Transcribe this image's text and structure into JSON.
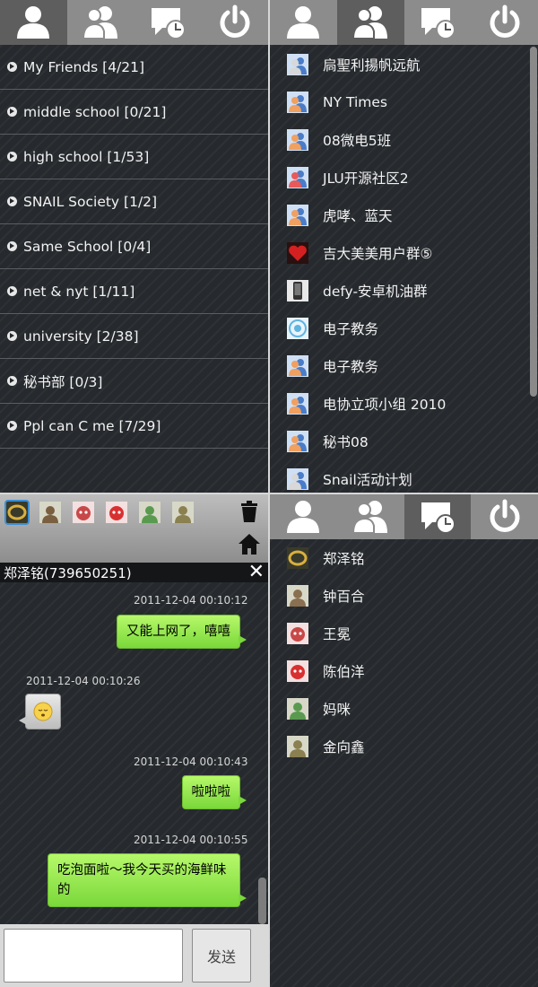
{
  "groups": [
    {
      "label": "My Friends [4/21]"
    },
    {
      "label": "middle school [0/21]"
    },
    {
      "label": "high school [1/53]"
    },
    {
      "label": "SNAIL Society [1/2]"
    },
    {
      "label": "Same School [0/4]"
    },
    {
      "label": "net & nyt [1/11]"
    },
    {
      "label": "university [2/38]"
    },
    {
      "label": "秘书部 [0/3]"
    },
    {
      "label": "Ppl can C me [7/29]"
    }
  ],
  "group_chats": [
    {
      "label": "扃聖利揚帆远航",
      "icon": "group-avatar-icon",
      "color": "#d8d8d8"
    },
    {
      "label": "NY Times",
      "icon": "group-avatar-icon",
      "color": "#f0a060"
    },
    {
      "label": "08微电5班",
      "icon": "group-avatar-icon",
      "color": "#f0a060"
    },
    {
      "label": "JLU开源社区2",
      "icon": "group-avatar-icon",
      "color": "#e85a5a"
    },
    {
      "label": "虎哮、蓝天",
      "icon": "group-avatar-icon",
      "color": "#f0a060"
    },
    {
      "label": "吉大美美用户群⑤",
      "icon": "heart-icon",
      "color": "#d42020"
    },
    {
      "label": "defy-安卓机油群",
      "icon": "phone-icon",
      "color": "#cfcfcf"
    },
    {
      "label": "电子教务",
      "icon": "school-logo-icon",
      "color": "#5fb4e0"
    },
    {
      "label": "电子教务",
      "icon": "group-avatar-icon",
      "color": "#f0a060"
    },
    {
      "label": "电协立项小组 2010",
      "icon": "group-avatar-icon",
      "color": "#f0a060"
    },
    {
      "label": "秘书08",
      "icon": "group-avatar-icon",
      "color": "#f0a060"
    },
    {
      "label": "Snail活动计划",
      "icon": "group-avatar-icon",
      "color": "#d8d8d8"
    }
  ],
  "recent": [
    {
      "label": "郑泽铭",
      "icon": "ring-avatar-icon",
      "color": "#d8b040"
    },
    {
      "label": "钟百合",
      "icon": "photo-avatar-icon",
      "color": "#8a7050"
    },
    {
      "label": "王冕",
      "icon": "cartoon-avatar-icon",
      "color": "#c84848"
    },
    {
      "label": "陈伯洋",
      "icon": "cartoon-avatar-icon",
      "color": "#d83030"
    },
    {
      "label": "妈咪",
      "icon": "photo-avatar-icon",
      "color": "#5a9a50"
    },
    {
      "label": "金向鑫",
      "icon": "photo-avatar-icon",
      "color": "#8a8050"
    }
  ],
  "chat": {
    "title": "郑泽铭(739650251)",
    "close": "✕",
    "send_label": "发送",
    "avatars": [
      {
        "name": "ring-avatar-icon",
        "color": "#d8b040"
      },
      {
        "name": "photo-avatar-icon",
        "color": "#7a6040"
      },
      {
        "name": "cartoon-avatar-icon",
        "color": "#c84848"
      },
      {
        "name": "cartoon-avatar-icon",
        "color": "#d83030"
      },
      {
        "name": "photo-avatar-icon",
        "color": "#5a9a50"
      },
      {
        "name": "photo-avatar-icon",
        "color": "#8a8050"
      }
    ],
    "messages": [
      {
        "time": "2011-12-04 00:10:12",
        "text": "又能上网了，嘻嘻",
        "from": "me"
      },
      {
        "time": "2011-12-04 00:10:26",
        "text": "",
        "from": "them",
        "emoji": "sleepy-face-emoji-icon"
      },
      {
        "time": "2011-12-04 00:10:43",
        "text": "啦啦啦",
        "from": "me"
      },
      {
        "time": "2011-12-04 00:10:55",
        "text": "吃泡面啦～我今天买的海鲜味的",
        "from": "me"
      }
    ]
  },
  "colors": {
    "accent_bubble": "#8be04a",
    "tab_active": "#5e5e5e",
    "tab_bar": "#8c8c8c"
  }
}
